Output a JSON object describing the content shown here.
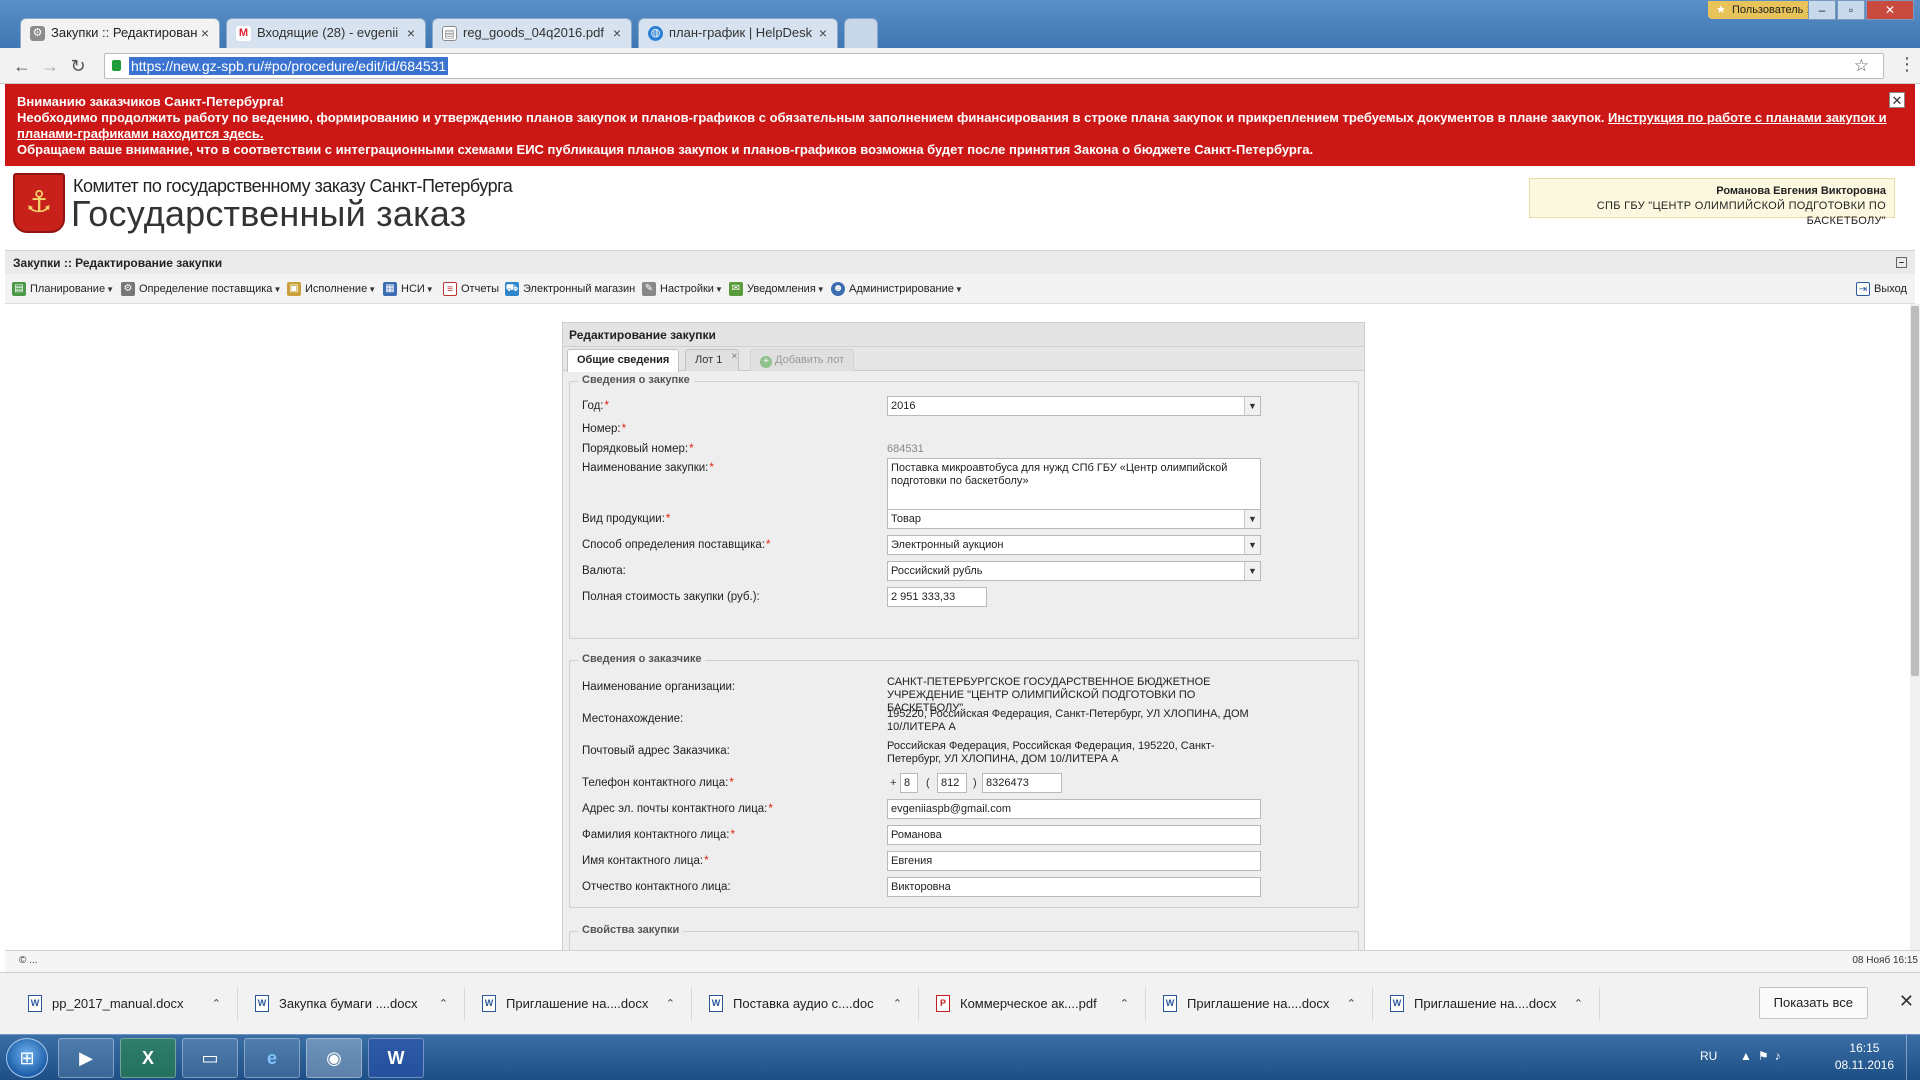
{
  "browser": {
    "tabs": [
      {
        "label": "Закупки :: Редактирован",
        "icon": "gear-icon",
        "active": true
      },
      {
        "label": "Входящие (28) - evgenii",
        "icon": "gmail-icon",
        "active": false
      },
      {
        "label": "reg_goods_04q2016.pdf",
        "icon": "document-icon",
        "active": false
      },
      {
        "label": "план-график | HelpDesk",
        "icon": "globe-icon",
        "active": false
      }
    ],
    "profile": "Пользователь 1",
    "url": "https://new.gz-spb.ru/#po/procedure/edit/id/684531"
  },
  "announcement": {
    "line1": "Вниманию заказчиков Санкт-Петербурга!",
    "line2": "Необходимо продолжить работу по ведению, формированию и утверждению планов закупок и планов-графиков с обязательным заполнением финансирования в строке плана закупок и прикреплением требуемых документов в плане закупок.",
    "link": "Инструкция по работе с планами закупок и планами-графиками находится здесь.",
    "line3": "Обращаем ваше внимание, что в соответствии с интеграционными схемами ЕИС публикация планов закупок и планов-графиков возможна будет после принятия Закона о бюджете Санкт-Петербурга."
  },
  "site": {
    "subtitle": "Комитет по государственному заказу Санкт-Петербурга",
    "title": "Государственный заказ",
    "user_name": "Романова Евгения Викторовна",
    "user_org": "СПБ ГБУ \"ЦЕНТР ОЛИМПИЙСКОЙ ПОДГОТОВКИ ПО БАСКЕТБОЛУ\""
  },
  "app": {
    "breadcrumb": "Закупки :: Редактирование закупки",
    "menu": [
      {
        "label": "Планирование",
        "icon": "planning-icon",
        "dropdown": true
      },
      {
        "label": "Определение поставщика",
        "icon": "supplier-icon",
        "dropdown": true
      },
      {
        "label": "Исполнение",
        "icon": "execution-icon",
        "dropdown": true
      },
      {
        "label": "НСИ",
        "icon": "reference-icon",
        "dropdown": true
      },
      {
        "label": "Отчеты",
        "icon": "report-icon",
        "dropdown": false
      },
      {
        "label": "Электронный магазин",
        "icon": "cart-icon",
        "dropdown": false
      },
      {
        "label": "Настройки",
        "icon": "wrench-icon",
        "dropdown": true
      },
      {
        "label": "Уведомления",
        "icon": "notification-icon",
        "dropdown": true
      },
      {
        "label": "Администрирование",
        "icon": "user-icon",
        "dropdown": true
      }
    ],
    "logout": "Выход"
  },
  "form": {
    "title": "Редактирование закупки",
    "tabs": {
      "general": "Общие сведения",
      "lot1": "Лот 1",
      "add_lot": "Добавить лот"
    },
    "purchase_section": {
      "legend": "Сведения о закупке",
      "year_label": "Год:",
      "year_value": "2016",
      "number_label": "Номер:",
      "serial_label": "Порядковый номер:",
      "serial_value": "684531",
      "name_label": "Наименование закупки:",
      "name_value": "Поставка микроавтобуса для нужд СПб  ГБУ «Центр олимпийской подготовки по баскетболу»",
      "product_label": "Вид продукции:",
      "product_value": "Товар",
      "method_label": "Способ определения поставщика:",
      "method_value": "Электронный аукцион",
      "currency_label": "Валюта:",
      "currency_value": "Российский рубль",
      "cost_label": "Полная стоимость закупки (руб.):",
      "cost_value": "2 951 333,33"
    },
    "customer_section": {
      "legend": "Сведения о заказчике",
      "org_label": "Наименование организации:",
      "org_value": "САНКТ-ПЕТЕРБУРГСКОЕ ГОСУДАРСТВЕННОЕ БЮДЖЕТНОЕ УЧРЕЖДЕНИЕ \"ЦЕНТР ОЛИМПИЙСКОЙ ПОДГОТОВКИ ПО БАСКЕТБОЛУ\"",
      "location_label": "Местонахождение:",
      "location_value": "195220, Российская Федерация, Санкт-Петербург, УЛ ХЛОПИНА, ДОМ 10/ЛИТЕРА А",
      "postal_label": "Почтовый адрес Заказчика:",
      "postal_value": "Российская Федерация, Российская Федерация, 195220, Санкт-Петербург, УЛ ХЛОПИНА, ДОМ 10/ЛИТЕРА А",
      "phone_label": "Телефон контактного лица:",
      "phone_plus": "+",
      "phone_country": "8",
      "phone_open": "(",
      "phone_code": "812",
      "phone_close": ")",
      "phone_number": "8326473",
      "email_label": "Адрес эл. почты контактного лица:",
      "email_value": "evgeniiaspb@gmail.com",
      "lastname_label": "Фамилия контактного лица:",
      "lastname_value": "Романова",
      "firstname_label": "Имя контактного лица:",
      "firstname_value": "Евгения",
      "middlename_label": "Отчество контактного лица:",
      "middlename_value": "Викторовна"
    },
    "props_section": {
      "legend": "Свойства закупки"
    }
  },
  "status": {
    "left": "© ...",
    "right": "08 Нояб 16:15"
  },
  "downloads": {
    "items": [
      {
        "name": "pp_2017_manual.docx",
        "type": "word"
      },
      {
        "name": "Закупка  бумаги ....docx",
        "type": "word"
      },
      {
        "name": "Приглашение на....docx",
        "type": "word"
      },
      {
        "name": "Поставка аудио с....doc",
        "type": "word"
      },
      {
        "name": "Коммерческое ак....pdf",
        "type": "pdf"
      },
      {
        "name": "Приглашение на....docx",
        "type": "word"
      },
      {
        "name": "Приглашение на....docx",
        "type": "word"
      }
    ],
    "show_all": "Показать все"
  },
  "taskbar": {
    "lang": "RU",
    "time": "16:15",
    "date": "08.11.2016",
    "apps": [
      "media-player-icon",
      "excel-icon",
      "explorer-icon",
      "internet-explorer-icon",
      "chrome-icon",
      "word-icon"
    ]
  },
  "colors": {
    "announcement_bg": "#cc1717",
    "brand_red": "#c8201b",
    "taskbar": "#1d4f86"
  }
}
